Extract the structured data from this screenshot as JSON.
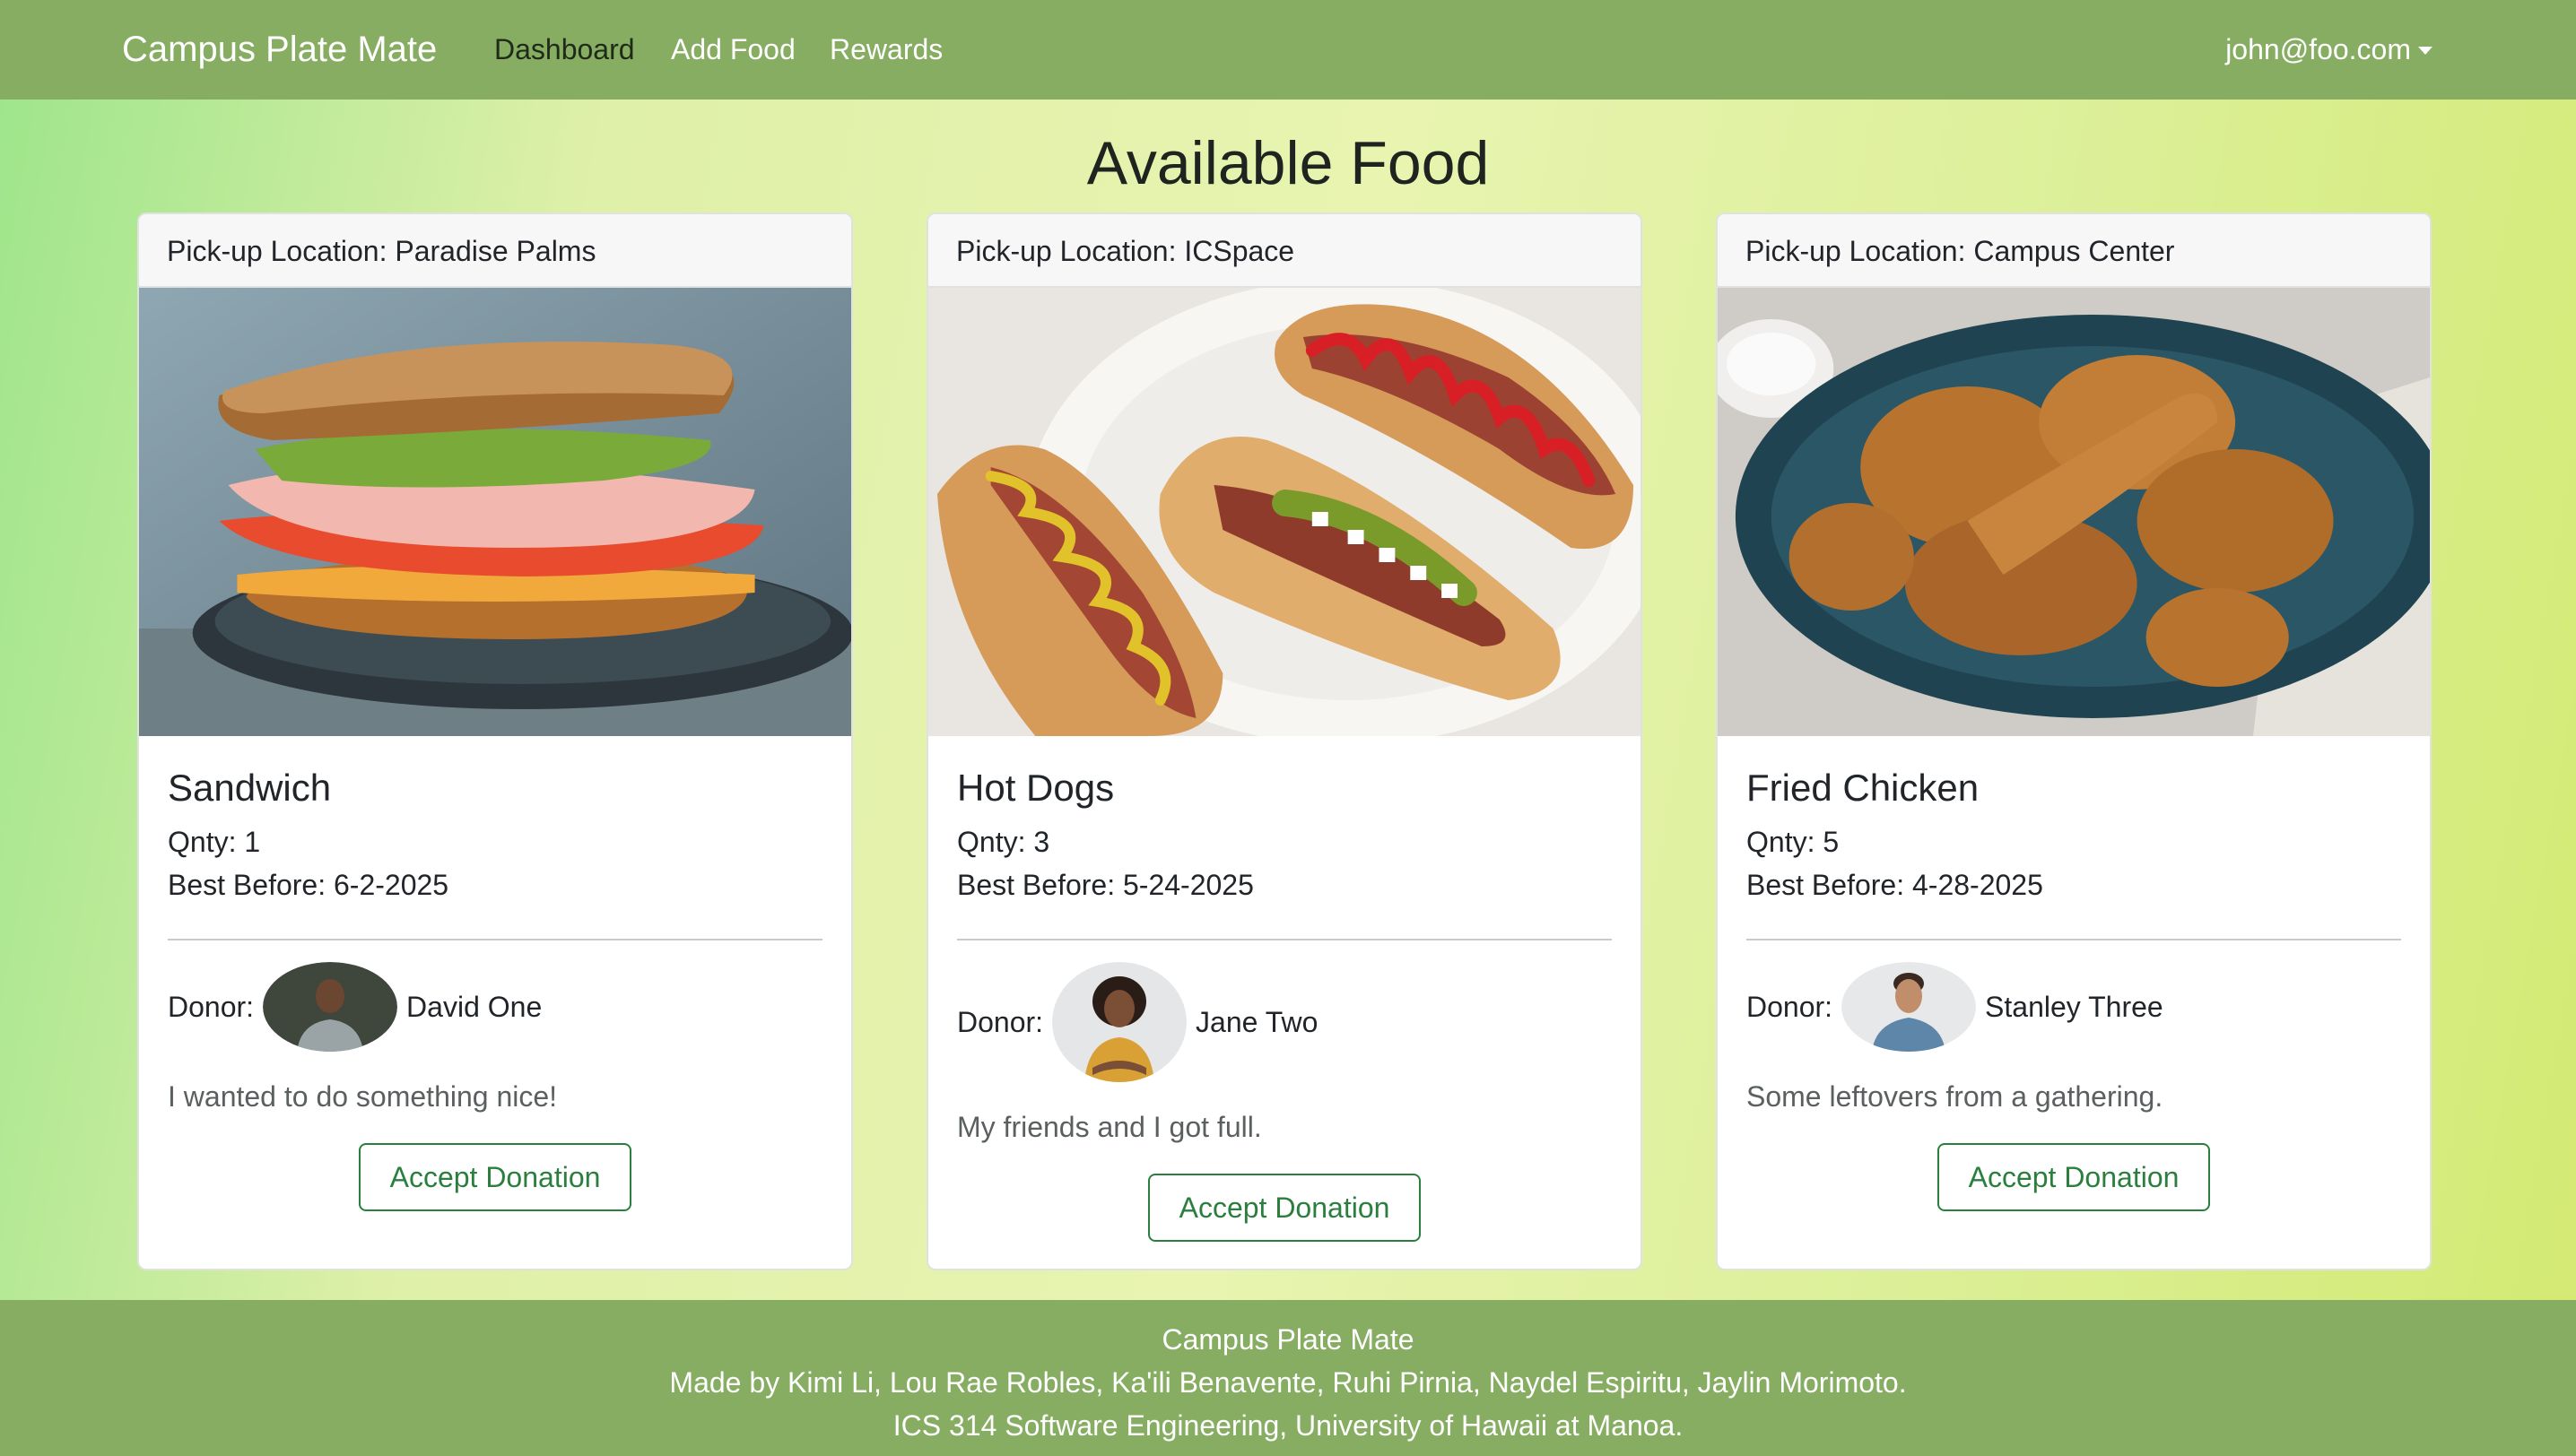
{
  "navbar": {
    "brand": "Campus Plate Mate",
    "links": [
      {
        "label": "Dashboard",
        "active": true
      },
      {
        "label": "Add Food",
        "active": false
      },
      {
        "label": "Rewards",
        "active": false
      }
    ],
    "user": "john@foo.com",
    "bg_color": "#86ad62"
  },
  "page": {
    "title": "Available Food"
  },
  "cards": [
    {
      "location": "Pick-up Location: Paradise Palms",
      "image_icon": "sandwich-photo",
      "name": "Sandwich",
      "qnty": "Qnty: 1",
      "best_before": "Best Before: 6-2-2025",
      "donor_label": "Donor:",
      "donor_name": "David One",
      "message": "I wanted to do something nice!",
      "button": "Accept Donation"
    },
    {
      "location": "Pick-up Location: ICSpace",
      "image_icon": "hot-dogs-photo",
      "name": "Hot Dogs",
      "qnty": "Qnty: 3",
      "best_before": "Best Before: 5-24-2025",
      "donor_label": "Donor:",
      "donor_name": "Jane Two",
      "message": "My friends and I got full.",
      "button": "Accept Donation"
    },
    {
      "location": "Pick-up Location: Campus Center",
      "image_icon": "fried-chicken-photo",
      "name": "Fried Chicken",
      "qnty": "Qnty: 5",
      "best_before": "Best Before: 4-28-2025",
      "donor_label": "Donor:",
      "donor_name": "Stanley Three",
      "message": "Some leftovers from a gathering.",
      "button": "Accept Donation"
    }
  ],
  "footer": {
    "line1": "Campus Plate Mate",
    "line2": "Made by Kimi Li, Lou Rae Robles, Ka'ili Benavente, Ruhi Pirnia, Naydel Espiritu, Jaylin Morimoto.",
    "line3": "ICS 314 Software Engineering, University of Hawaii at Manoa."
  },
  "colors": {
    "accent_green": "#2b7f3e",
    "nav_green": "#86ad62"
  }
}
